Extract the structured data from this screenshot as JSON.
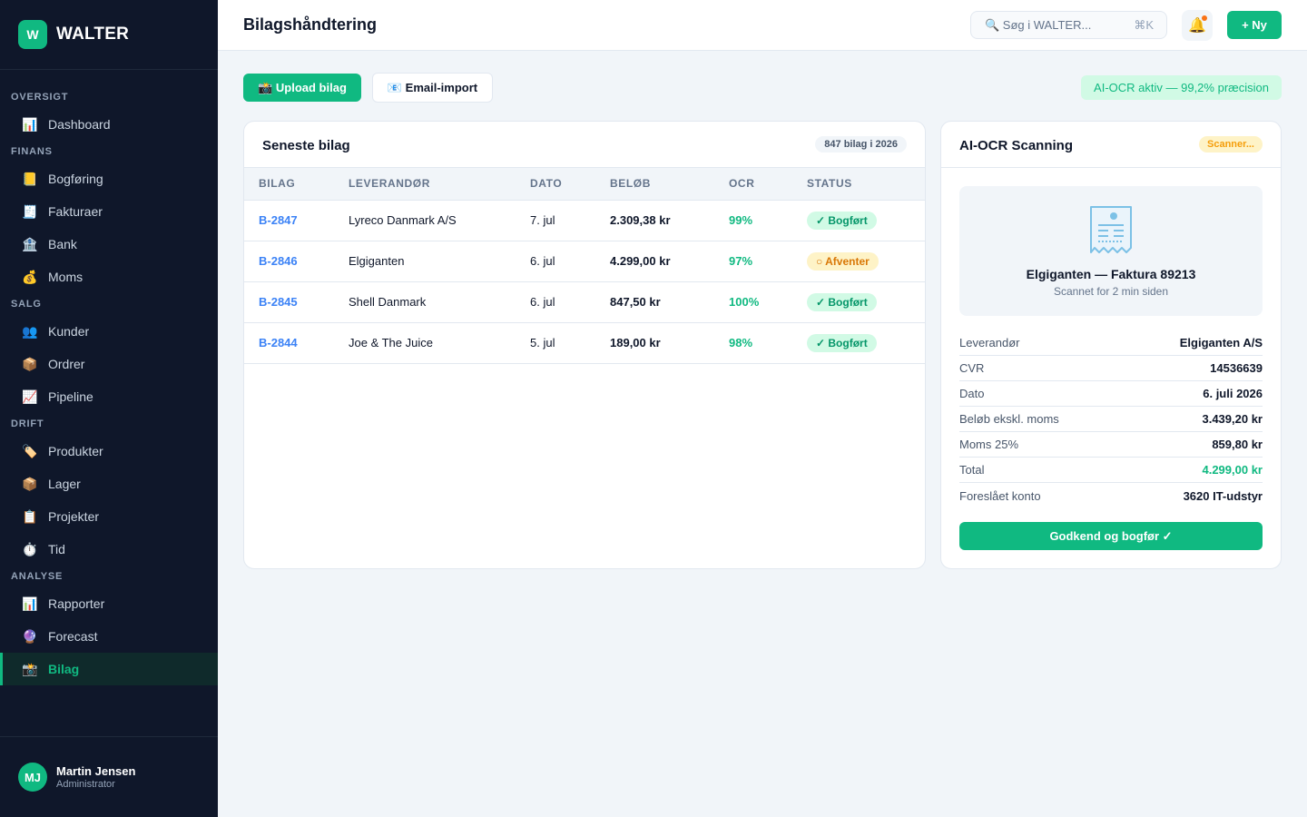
{
  "brand": {
    "logo_letter": "W",
    "name": "WALTER"
  },
  "sidebar": {
    "sections": [
      {
        "title": "OVERSIGT",
        "items": [
          {
            "icon": "📊",
            "icon_name": "chart-icon",
            "label": "Dashboard"
          }
        ]
      },
      {
        "title": "FINANS",
        "items": [
          {
            "icon": "📒",
            "icon_name": "ledger-icon",
            "label": "Bogføring"
          },
          {
            "icon": "🧾",
            "icon_name": "receipt-icon",
            "label": "Fakturaer"
          },
          {
            "icon": "🏦",
            "icon_name": "bank-icon",
            "label": "Bank"
          },
          {
            "icon": "💰",
            "icon_name": "money-bag-icon",
            "label": "Moms"
          }
        ]
      },
      {
        "title": "SALG",
        "items": [
          {
            "icon": "👥",
            "icon_name": "users-icon",
            "label": "Kunder"
          },
          {
            "icon": "📦",
            "icon_name": "package-icon",
            "label": "Ordrer"
          },
          {
            "icon": "📈",
            "icon_name": "trend-icon",
            "label": "Pipeline"
          }
        ]
      },
      {
        "title": "DRIFT",
        "items": [
          {
            "icon": "🏷️",
            "icon_name": "tag-icon",
            "label": "Produkter"
          },
          {
            "icon": "📦",
            "icon_name": "package-icon",
            "label": "Lager"
          },
          {
            "icon": "📋",
            "icon_name": "clipboard-icon",
            "label": "Projekter"
          },
          {
            "icon": "⏱️",
            "icon_name": "stopwatch-icon",
            "label": "Tid"
          }
        ]
      },
      {
        "title": "ANALYSE",
        "items": [
          {
            "icon": "📊",
            "icon_name": "chart-icon",
            "label": "Rapporter"
          },
          {
            "icon": "🔮",
            "icon_name": "crystal-ball-icon",
            "label": "Forecast"
          },
          {
            "icon": "📸",
            "icon_name": "camera-icon",
            "label": "Bilag",
            "active": true
          }
        ]
      }
    ]
  },
  "user": {
    "initials": "MJ",
    "name": "Martin Jensen",
    "role": "Administrator"
  },
  "header": {
    "title": "Bilagshåndtering",
    "search_placeholder": "🔍 Søg i WALTER...",
    "search_shortcut": "⌘K",
    "bell_icon": "🔔",
    "new_button": "+ Ny"
  },
  "actions": {
    "upload": "📸 Upload bilag",
    "email_import": "📧 Email-import",
    "ocr_status": "AI-OCR aktiv — 99,2% præcision"
  },
  "recent": {
    "title": "Seneste bilag",
    "count_badge": "847 bilag i 2026",
    "columns": [
      "BILAG",
      "LEVERANDØR",
      "DATO",
      "BELØB",
      "OCR",
      "STATUS"
    ],
    "rows": [
      {
        "id": "B-2847",
        "supplier": "Lyreco Danmark A/S",
        "date": "7. jul",
        "amount": "2.309,38 kr",
        "ocr": "99%",
        "status": "✓ Bogført",
        "status_type": "ok"
      },
      {
        "id": "B-2846",
        "supplier": "Elgiganten",
        "date": "6. jul",
        "amount": "4.299,00 kr",
        "ocr": "97%",
        "status": "○ Afventer",
        "status_type": "pending"
      },
      {
        "id": "B-2845",
        "supplier": "Shell Danmark",
        "date": "6. jul",
        "amount": "847,50 kr",
        "ocr": "100%",
        "status": "✓ Bogført",
        "status_type": "ok"
      },
      {
        "id": "B-2844",
        "supplier": "Joe & The Juice",
        "date": "5. jul",
        "amount": "189,00 kr",
        "ocr": "98%",
        "status": "✓ Bogført",
        "status_type": "ok"
      }
    ]
  },
  "scanner": {
    "title": "AI-OCR Scanning",
    "badge": "Scanner...",
    "preview_title": "Elgiganten — Faktura 89213",
    "preview_sub": "Scannet for 2 min siden",
    "fields": [
      {
        "label": "Leverandør",
        "value": "Elgiganten A/S"
      },
      {
        "label": "CVR",
        "value": "14536639"
      },
      {
        "label": "Dato",
        "value": "6. juli 2026"
      },
      {
        "label": "Beløb ekskl. moms",
        "value": "3.439,20 kr"
      },
      {
        "label": "Moms 25%",
        "value": "859,80 kr"
      },
      {
        "label": "Total",
        "value": "4.299,00 kr",
        "highlight": true
      },
      {
        "label": "Foreslået konto",
        "value": "3620 IT-udstyr"
      }
    ],
    "approve_button": "Godkend og bogfør ✓"
  },
  "colors": {
    "accent": "#10b981",
    "sidebar_bg": "#0f172a",
    "link": "#3b82f6",
    "pending": "#d97706"
  }
}
